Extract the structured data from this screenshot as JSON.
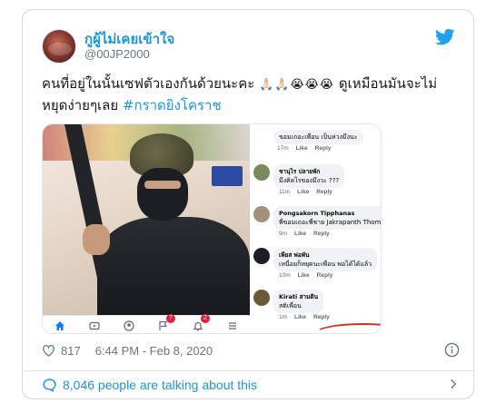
{
  "tweet": {
    "display_name": "กูผู้ไม่เคยเข้าใจ",
    "handle": "@00JP2000",
    "text_part1": "คนที่อยู่ในนั้นเซฟตัวเองกันด้วยนะคะ",
    "emojis": "🙏🏻🙏🏻😭😭😭",
    "text_part2": "ดูเหมือนมันจะไม่หยุดง่ายๆเลย",
    "hashtag": "#กราดยิงโคราช",
    "like_count": "817",
    "timestamp": "6:44 PM - Feb 8, 2020",
    "talking_text": "8,046 people are talking about this"
  },
  "embedded_screenshot": {
    "nav_badges": [
      "7",
      "2"
    ],
    "comments": [
      {
        "author": "",
        "text": "ขอมเถอะเพื่อน เป็นห่วงมึงนะ",
        "time": "17m",
        "like": "Like",
        "reply": "Reply"
      },
      {
        "author": "ชานุไร ปลายพัก",
        "text": "มึงคิดไรของมึงวะ ???",
        "time": "11m",
        "like": "Like",
        "reply": "Reply"
      },
      {
        "author": "Pongsakorn Tipphanas",
        "text": "พี่ขอมเถอะพี่ชาย Jakrapanth Thomma",
        "time": "9m",
        "like": "Like",
        "reply": "Reply"
      },
      {
        "author": "เพียส พ่อพัน",
        "text": "เหนื่อยก็หยุดนะเพื่อน พอได้ได้แล้ว",
        "time": "10m",
        "like": "Like",
        "reply": "Reply"
      },
      {
        "author": "Kirati สามดิน",
        "text": "สติเพื่อน",
        "time": "1m",
        "like": "Like",
        "reply": "Reply"
      }
    ]
  },
  "colors": {
    "accent": "#1b95e0",
    "muted": "#657786",
    "border": "#cfd9de"
  }
}
